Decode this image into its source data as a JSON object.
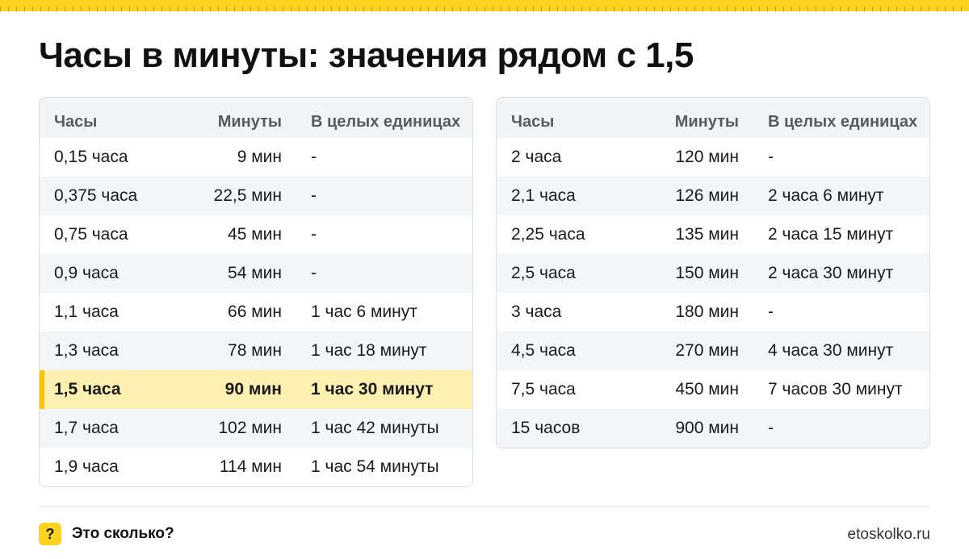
{
  "title": "Часы в минуты: значения рядом с 1,5",
  "colors": {
    "accent": "#ffd21f",
    "highlight_row": "#fdf0b0",
    "stripe": "#f4f5f7"
  },
  "headers": {
    "hours": "Часы",
    "minutes": "Минуты",
    "whole": "В целых единицах"
  },
  "left_table": {
    "rows": [
      {
        "hours": "0,15 часа",
        "minutes": "9 мин",
        "whole": "-"
      },
      {
        "hours": "0,375 часа",
        "minutes": "22,5 мин",
        "whole": "-"
      },
      {
        "hours": "0,75 часа",
        "minutes": "45 мин",
        "whole": "-"
      },
      {
        "hours": "0,9 часа",
        "minutes": "54 мин",
        "whole": "-"
      },
      {
        "hours": "1,1 часа",
        "minutes": "66 мин",
        "whole": "1 час 6 минут"
      },
      {
        "hours": "1,3 часа",
        "minutes": "78 мин",
        "whole": "1 час 18 минут"
      },
      {
        "hours": "1,5 часа",
        "minutes": "90 мин",
        "whole": "1 час 30 минут",
        "highlighted": true
      },
      {
        "hours": "1,7 часа",
        "minutes": "102 мин",
        "whole": "1 час 42 минуты"
      },
      {
        "hours": "1,9 часа",
        "minutes": "114 мин",
        "whole": "1 час 54 минуты"
      }
    ]
  },
  "right_table": {
    "rows": [
      {
        "hours": "2 часа",
        "minutes": "120 мин",
        "whole": "-"
      },
      {
        "hours": "2,1 часа",
        "minutes": "126 мин",
        "whole": "2 часа 6 минут"
      },
      {
        "hours": "2,25 часа",
        "minutes": "135 мин",
        "whole": "2 часа 15 минут"
      },
      {
        "hours": "2,5 часа",
        "minutes": "150 мин",
        "whole": "2 часа 30 минут"
      },
      {
        "hours": "3 часа",
        "minutes": "180 мин",
        "whole": "-"
      },
      {
        "hours": "4,5 часа",
        "minutes": "270 мин",
        "whole": "4 часа 30 минут"
      },
      {
        "hours": "7,5 часа",
        "minutes": "450 мин",
        "whole": "7 часов 30 минут"
      },
      {
        "hours": "15 часов",
        "minutes": "900 мин",
        "whole": "-"
      }
    ]
  },
  "footer": {
    "badge_glyph": "?",
    "badge_icon": "question-icon",
    "brand": "Это сколько?",
    "site": "etoskolko.ru"
  }
}
